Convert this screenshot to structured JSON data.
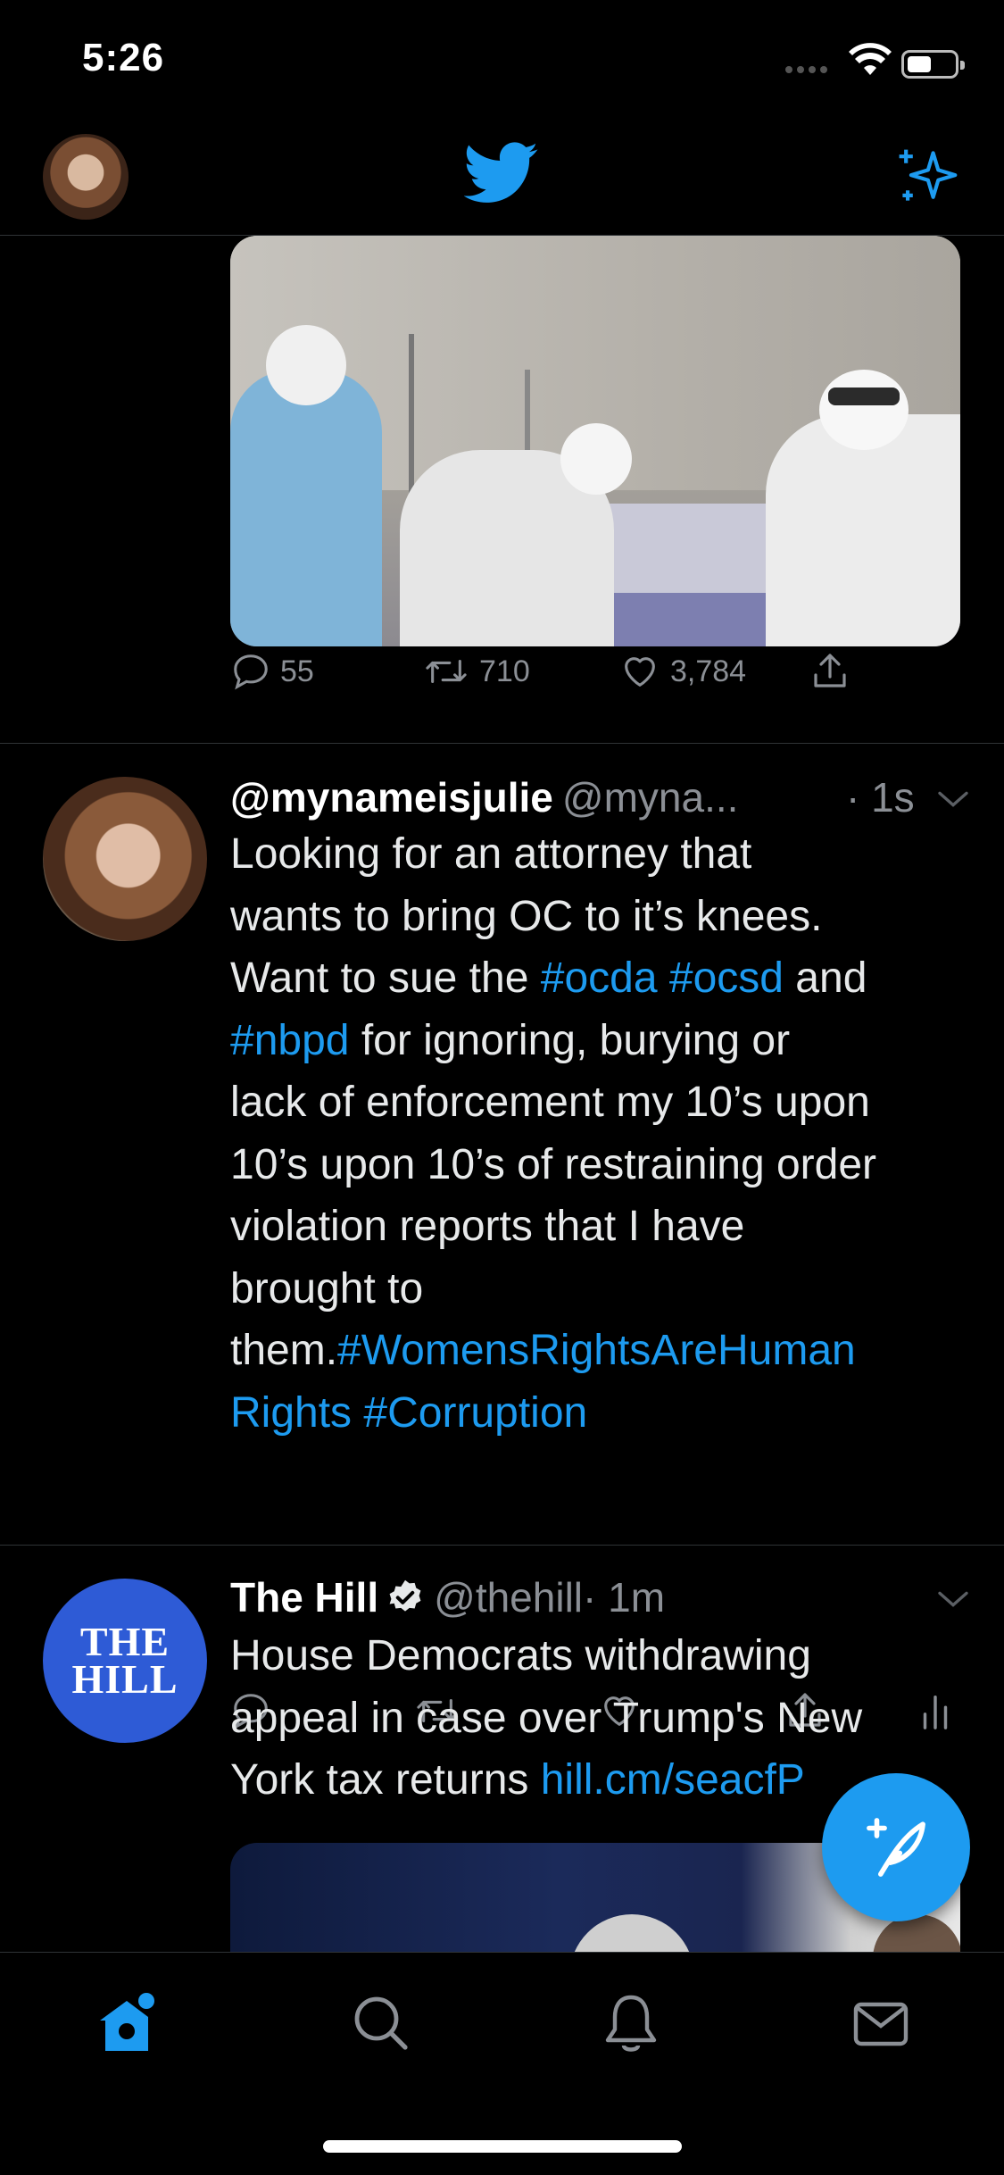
{
  "status_bar": {
    "time": "5:26"
  },
  "colors": {
    "accent": "#1d9bf0",
    "background": "#000000",
    "muted": "#8b8f95"
  },
  "top_nav": {
    "logo_icon": "twitter-bird-icon",
    "sparkle_icon": "sparkle-icon"
  },
  "tweets": [
    {
      "media_icon": "photo",
      "actions": {
        "replies": "55",
        "retweets": "710",
        "likes": "3,784"
      }
    },
    {
      "display_name": "@mynameisjulie",
      "handle": "@myna...",
      "time": "· 1s",
      "lines": [
        "Looking for an attorney that",
        "wants to bring OC to it’s knees.",
        [
          "Want to sue the ",
          "#ocda",
          " ",
          "#ocsd",
          " and"
        ],
        [
          "#nbpd",
          " for ignoring, burying or"
        ],
        "lack of enforcement my 10’s upon",
        "10’s upon 10’s of restraining order",
        "violation reports that I have",
        "brought to",
        [
          "them.",
          "#WomensRightsAreHuman"
        ],
        [
          "Rights",
          " ",
          "#Corruption"
        ]
      ]
    },
    {
      "display_name": "The Hill",
      "avatar_text_1": "THE",
      "avatar_text_2": "HILL",
      "handle": "@thehill",
      "time": "· 1m",
      "line1": "House Democrats withdrawing",
      "line2": "appeal in case over Trump's New",
      "line3_text": "York tax returns ",
      "line3_link": "hill.cm/seacfP"
    }
  ],
  "tab_bar": {
    "items": [
      {
        "name": "home-icon",
        "active": true
      },
      {
        "name": "search-icon",
        "active": false
      },
      {
        "name": "notifications-icon",
        "active": false
      },
      {
        "name": "messages-icon",
        "active": false
      }
    ]
  }
}
